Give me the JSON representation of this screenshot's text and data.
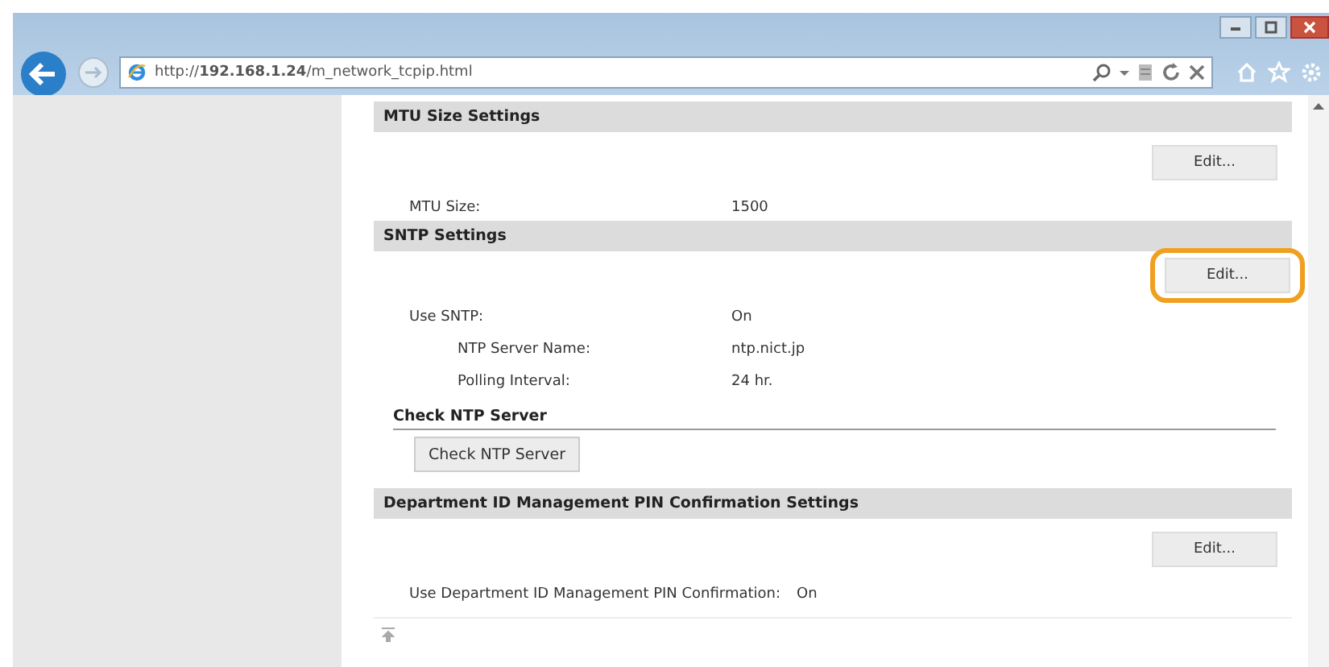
{
  "browser": {
    "url": "http://**192.168.1.24**/m_network_tcpip.html"
  },
  "sections": [
    {
      "title": "MTU Size Settings",
      "edit_button": {
        "label": "Edit...",
        "highlighted": false
      },
      "rows": [
        {
          "label": "MTU Size:",
          "value": "1500"
        }
      ]
    },
    {
      "title": "SNTP Settings",
      "edit_button": {
        "label": "Edit...",
        "highlighted": true
      },
      "rows": [
        {
          "label": "Use SNTP:",
          "value": "On",
          "children": [
            {
              "label": "NTP Server Name:",
              "value": "ntp.nict.jp"
            },
            {
              "label": "Polling Interval:",
              "value": "24 hr."
            }
          ]
        }
      ],
      "subsection": {
        "title": "Check NTP Server",
        "button": "Check NTP Server"
      }
    },
    {
      "title": "Department ID Management PIN Confirmation Settings",
      "edit_button": {
        "label": "Edit...",
        "highlighted": false
      },
      "rows": [
        {
          "label": "Use Department ID Management PIN Confirmation:",
          "value": "On"
        }
      ]
    }
  ]
}
